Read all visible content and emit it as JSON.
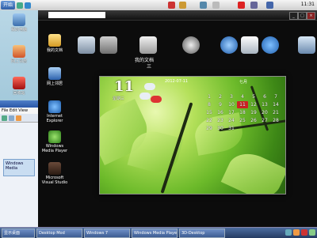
{
  "topbar": {
    "start_label": "开始",
    "clock": "11:31"
  },
  "desktop": {
    "icons": [
      {
        "label": "我的电脑"
      },
      {
        "label": "网上邻居"
      },
      {
        "label": "回收站"
      }
    ]
  },
  "explorer": {
    "title": "",
    "menu": "File  Edit  View",
    "item_label": "Windows Media"
  },
  "window": {
    "address": "",
    "icons": [
      {
        "label": "我的文档"
      },
      {
        "label": "网上邻居"
      },
      {
        "label": "Internet Explorer"
      },
      {
        "label": "Windows Media Player"
      },
      {
        "label": "Microsoft Visual Studio"
      }
    ],
    "dock_label": "我的文档"
  },
  "widget": {
    "day": "11",
    "day_sub": "星期三",
    "weekday": "三",
    "time": "2012-07-11",
    "month": "七月",
    "calendar": [
      [
        "",
        "",
        "",
        "",
        "",
        "",
        ""
      ],
      [
        "1",
        "2",
        "3",
        "4",
        "5",
        "6",
        "7"
      ],
      [
        "8",
        "9",
        "10",
        "11",
        "12",
        "13",
        "14"
      ],
      [
        "15",
        "16",
        "17",
        "18",
        "19",
        "20",
        "21"
      ],
      [
        "22",
        "23",
        "24",
        "25",
        "26",
        "27",
        "28"
      ],
      [
        "29",
        "30",
        "31",
        "",
        "",
        "",
        ""
      ]
    ],
    "selected": "11"
  },
  "taskbar": {
    "tasks": [
      {
        "label": "显示桌面"
      },
      {
        "label": "Desktop Mod"
      },
      {
        "label": "Windows 7"
      },
      {
        "label": "Windows Media Player"
      },
      {
        "label": "3D-Desktop"
      }
    ]
  },
  "colors": {
    "accent": "#2f5fa8",
    "selected_day": "#cc2222"
  }
}
